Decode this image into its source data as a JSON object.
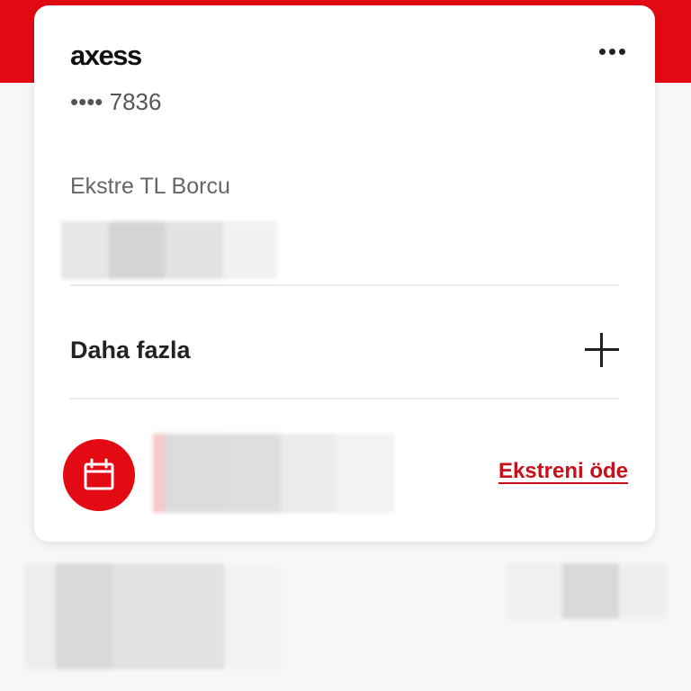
{
  "card": {
    "brand": "axess",
    "number_masked": "•••• 7836",
    "balance_label": "Ekstre TL Borcu",
    "more_label": "Daha fazla",
    "pay_link": "Ekstreni öde"
  },
  "icons": {
    "more": "more-horizontal-icon",
    "expand": "plus-icon",
    "calendar": "calendar-icon"
  },
  "colors": {
    "brand_red": "#e30a13",
    "link_red": "#c9101a"
  }
}
